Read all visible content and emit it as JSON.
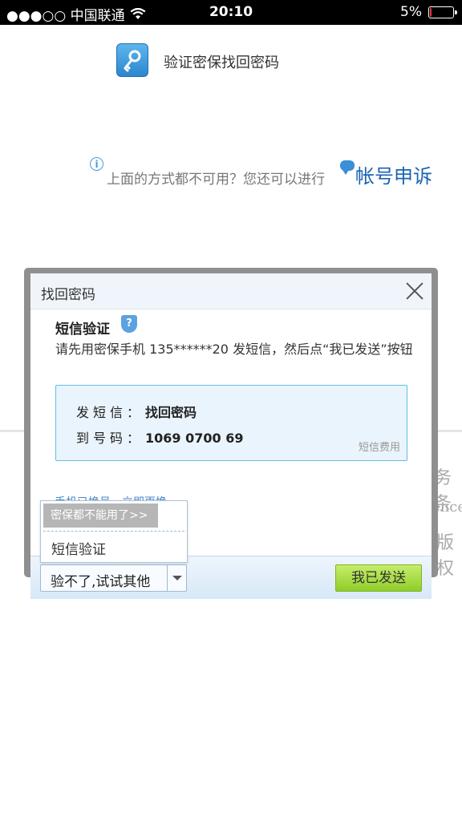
{
  "status_bar": {
    "carrier": "●●●○○ 中国联通",
    "wifi_icon": "wifi-icon",
    "time": "20:10",
    "battery": "5%",
    "battery_level": 0.05,
    "battery_color": "#e8323a"
  },
  "background": {
    "key_title": "验证密保找回密码",
    "alternative_text": "上面的方式都不可用？您还可以进行",
    "appeal_link": "帐号申诉",
    "fragments": [
      "务条",
      "ence",
      "版权"
    ]
  },
  "modal": {
    "title": "找回密码",
    "section_title": "短信验证",
    "instruction": "请先用密保手机 135******20 发短信，然后点“我已发送”按钮",
    "sms": {
      "send_label": "发短信：",
      "send_value": "找回密码",
      "number_label": "到号码：",
      "number_value": "1069 0700 69",
      "fee_link": "短信费用"
    },
    "phone_changed_link": "手机已换号，立即更换",
    "dropdown": {
      "selected_item": "密保都不能用了>>",
      "item": "短信验证"
    },
    "footer": {
      "other_button": "验不了,试试其他",
      "sent_button": "我已发送"
    }
  },
  "colors": {
    "accent_blue": "#1b63b4",
    "sms_box_border": "#62bde4",
    "sent_button": "#9bd33a"
  }
}
